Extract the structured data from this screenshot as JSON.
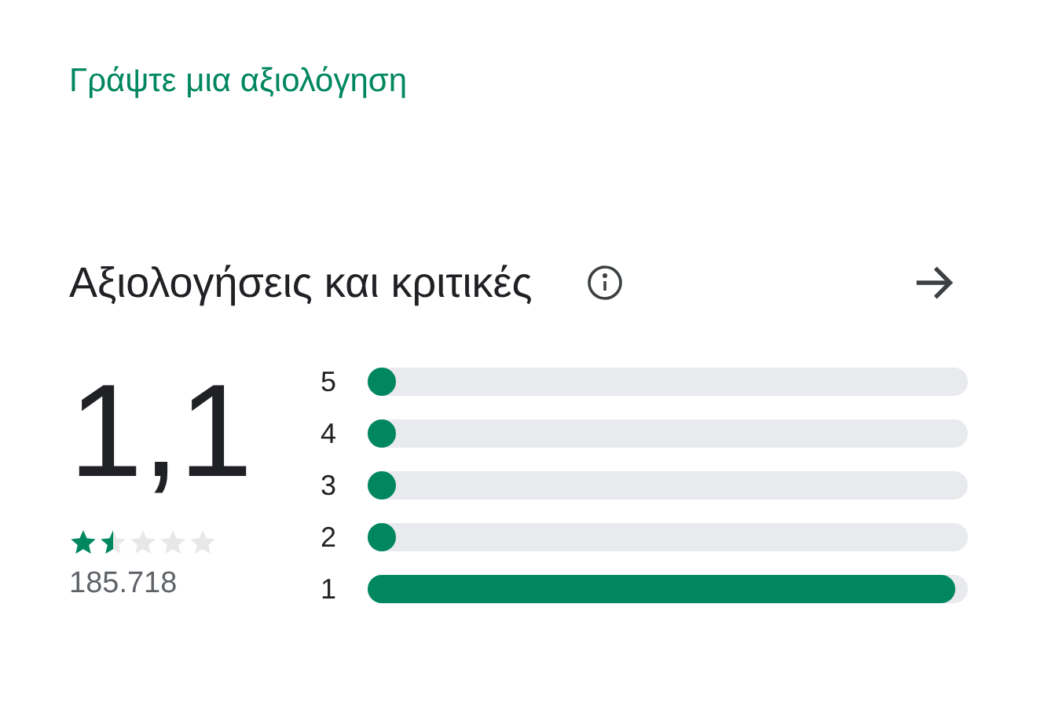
{
  "write_review_link": "Γράψτε μια αξιολόγηση",
  "section": {
    "title": "Αξιολογήσεις και κριτικές"
  },
  "summary": {
    "score": "1,1",
    "stars": 1.5,
    "count": "185.718"
  },
  "histogram": [
    {
      "label": "5",
      "level": 0.03
    },
    {
      "label": "4",
      "level": 0.03
    },
    {
      "label": "3",
      "level": 0.03
    },
    {
      "label": "2",
      "level": 0.03
    },
    {
      "label": "1",
      "level": 0.98
    }
  ]
}
